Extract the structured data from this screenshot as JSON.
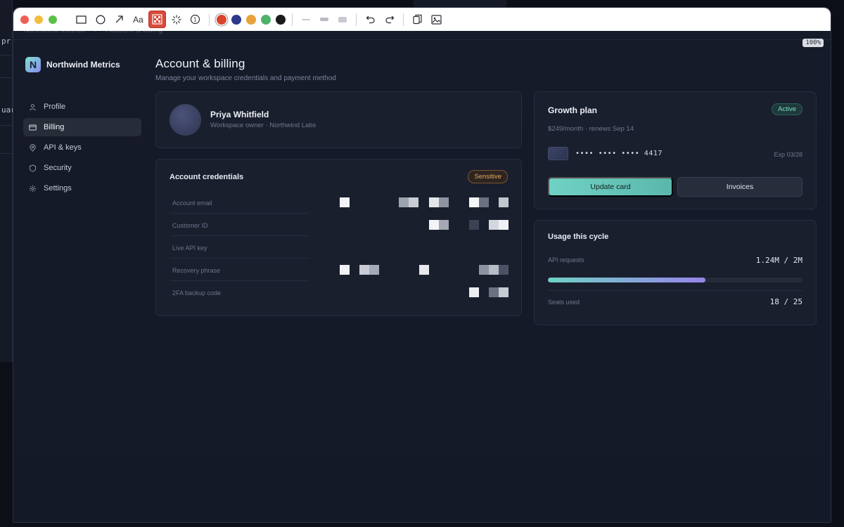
{
  "app": {
    "brand": "Northwind Metrics",
    "zoom": "100%",
    "breadcrumb_ghost": [
      "Northwind Metrics",
      "Account & billing"
    ]
  },
  "background": {
    "fragments": [
      "pr",
      "uar"
    ]
  },
  "toolbar": {
    "icons": [
      "rectangle-icon",
      "circle-icon",
      "arrow-icon",
      "text-icon",
      "pixelate-icon",
      "spotlight-icon",
      "counter-icon"
    ],
    "text_tool_label": "Aa",
    "counter_label": "1",
    "colors": [
      "#d9442f",
      "#2d3a8c",
      "#e8a23a",
      "#4fb26a",
      "#1b1b1b"
    ],
    "selected_color": "#d9442f"
  },
  "sidebar": {
    "items": [
      {
        "label": "Profile",
        "icon": "user-icon",
        "active": false
      },
      {
        "label": "Billing",
        "icon": "credit-card-icon",
        "active": true
      },
      {
        "label": "API & keys",
        "icon": "key-icon",
        "active": false
      },
      {
        "label": "Security",
        "icon": "shield-icon",
        "active": false
      },
      {
        "label": "Settings",
        "icon": "gear-icon",
        "active": false
      }
    ]
  },
  "page": {
    "title": "Account & billing",
    "subtitle": "Manage your workspace credentials and payment method"
  },
  "profile": {
    "name": "Priya Whitfield",
    "role": "Workspace owner · Northwind Labs"
  },
  "credentials": {
    "title": "Account credentials",
    "badge": "Sensitive",
    "rows": [
      {
        "label": "Account email"
      },
      {
        "label": "Customer ID"
      },
      {
        "label": "Live API key"
      },
      {
        "label": "Recovery phrase"
      },
      {
        "label": "2FA backup code"
      }
    ]
  },
  "plan": {
    "title": "Growth plan",
    "status": "Active",
    "price": "$249/month · renews Sep 14",
    "card_number": "•••• •••• •••• 4417",
    "expiry": "Exp 03/28",
    "update_label": "Update card",
    "invoices_label": "Invoices"
  },
  "usage": {
    "title": "Usage this cycle",
    "api_label": "API requests",
    "api_value": "1.24M / 2M",
    "api_fraction": 0.62,
    "seats_label": "Seats used",
    "seats_value": "18 / 25"
  },
  "colors": {
    "accent": "#6fd2c4",
    "accent_alt": "#9784e8",
    "sensitive": "#e8a862",
    "active": "#7fdccd"
  }
}
